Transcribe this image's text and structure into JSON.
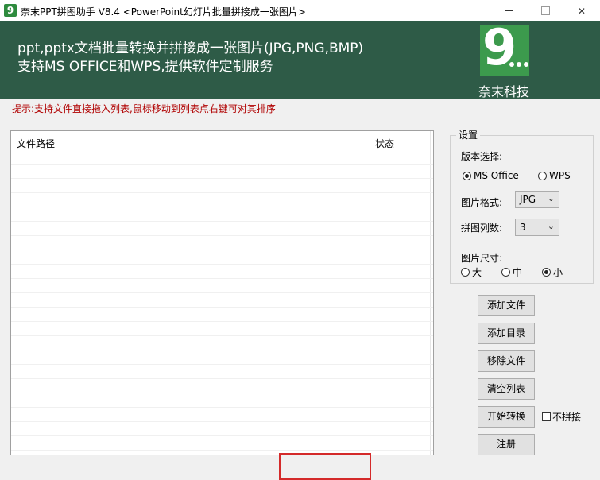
{
  "window": {
    "icon_glyph": "9",
    "title": "奈末PPT拼图助手 V8.4 <PowerPoint幻灯片批量拼接成一张图片>",
    "min_icon": "minimize-icon",
    "max_icon": "maximize-icon",
    "close_glyph": "✕"
  },
  "banner": {
    "line1": "ppt,pptx文档批量转换并拼接成一张图片(JPG,PNG,BMP)",
    "line2": "支持MS OFFICE和WPS,提供软件定制服务",
    "logo_text": "9",
    "company": "奈末科技",
    "bg_color": "#2e5b47",
    "logo_color": "#3c9a4d"
  },
  "hint": "提示:支持文件直接拖入列表,鼠标移动到列表点右键可对其排序",
  "file_list": {
    "columns": [
      "文件路径",
      "状态"
    ],
    "rows": []
  },
  "settings": {
    "group_title": "设置",
    "version_label": "版本选择:",
    "version_options": [
      "MS Office",
      "WPS"
    ],
    "version_selected": "MS Office",
    "format_label": "图片格式:",
    "format_value": "JPG",
    "columns_label": "拼图列数:",
    "columns_value": "3",
    "size_label": "图片尺寸:",
    "size_options": [
      "大",
      "中",
      "小"
    ],
    "size_selected": "小"
  },
  "buttons": {
    "add_file": "添加文件",
    "add_dir": "添加目录",
    "remove_file": "移除文件",
    "clear_list": "清空列表",
    "start": "开始转换",
    "register": "注册"
  },
  "no_stitch": {
    "label": "不拼接",
    "checked": false
  }
}
